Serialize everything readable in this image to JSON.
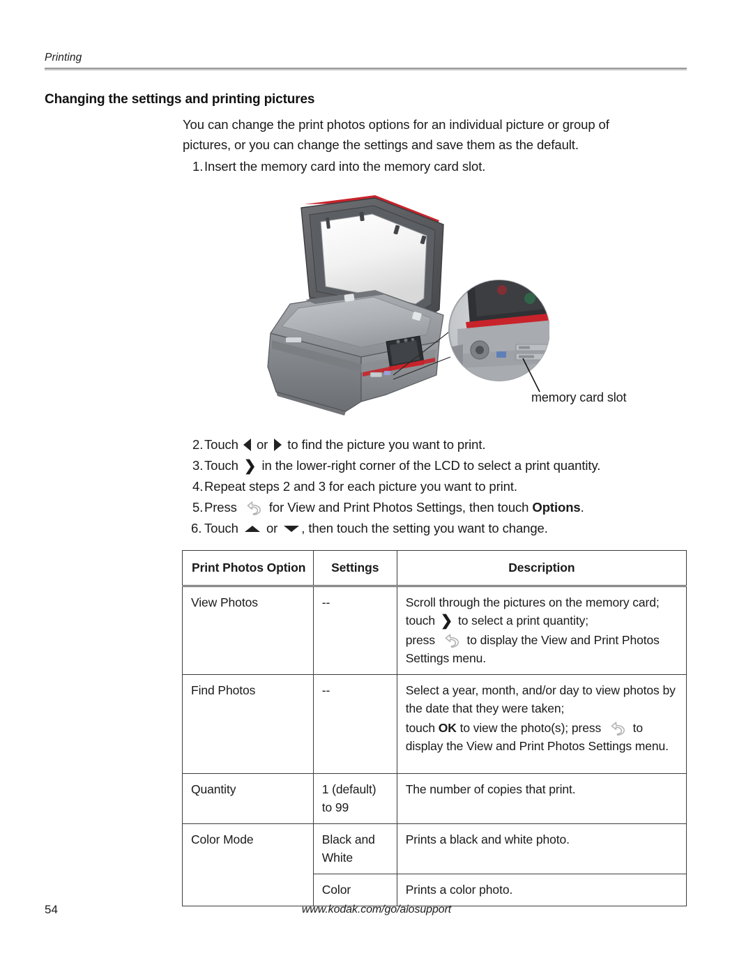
{
  "running_head": "Printing",
  "section_title": "Changing the settings and printing pictures",
  "intro": "You can change the print photos options for an individual picture or group of pictures, or you can change the settings and save them as the default.",
  "steps": [
    {
      "num": "1.",
      "pre": "Insert the memory card into the memory card slot.",
      "mid": "",
      "post": ""
    },
    {
      "num": "2.",
      "pre": "Touch ",
      "mid": " or ",
      "post": " to find the picture you want to print."
    },
    {
      "num": "3.",
      "pre": "Touch ",
      "mid": " in the lower-right corner of the LCD to select a print quantity.",
      "post": ""
    },
    {
      "num": "4.",
      "pre": "Repeat steps 2 and 3 for each picture you want to print.",
      "mid": "",
      "post": ""
    },
    {
      "num": "5.",
      "pre": "Press ",
      "mid": " for View and Print Photos Settings, then touch ",
      "post": "Options",
      "tail": "."
    },
    {
      "num": "6.",
      "pre": "Touch ",
      "mid": " or ",
      "post": ", then touch the setting you want to change."
    }
  ],
  "illustration": {
    "alt": "Kodak all-in-one printer with scanner lid open and magnified callout of the memory card slot",
    "callout_label": "memory card slot"
  },
  "table": {
    "headers": [
      "Print Photos Option",
      "Settings",
      "Description"
    ],
    "rows": [
      {
        "option": "View Photos",
        "settings": "--",
        "desc_1": "Scroll through the pictures on the memory card; touch ",
        "desc_2": " to select a print quantity;",
        "desc_3": "press ",
        "desc_4": " to display the View and Print Photos Settings menu."
      },
      {
        "option": "Find Photos",
        "settings": "--",
        "desc_1": "Select a year, month, and/or day to view photos by the date that they were taken;",
        "desc_2": "touch ",
        "desc_3": "OK",
        "desc_4": " to view the photo(s); press ",
        "desc_5": " to display the View and Print Photos Settings menu."
      },
      {
        "option": "Quantity",
        "settings": "1 (default) to 99",
        "desc_1": "The number of copies that print."
      },
      {
        "option": "Color Mode",
        "settings": "Black and White",
        "desc_1": "Prints a black and white photo."
      },
      {
        "option": "",
        "settings": "Color",
        "desc_1": "Prints a color photo."
      }
    ]
  },
  "footer": {
    "page_number": "54",
    "url": "www.kodak.com/go/aiosupport"
  },
  "colors": {
    "text": "#1a1a1a",
    "rule": "#9a9a9a",
    "table_border": "#3b3b3b",
    "icon_gray": "#b3b3b3",
    "printer_accent_red": "#c8232b"
  }
}
